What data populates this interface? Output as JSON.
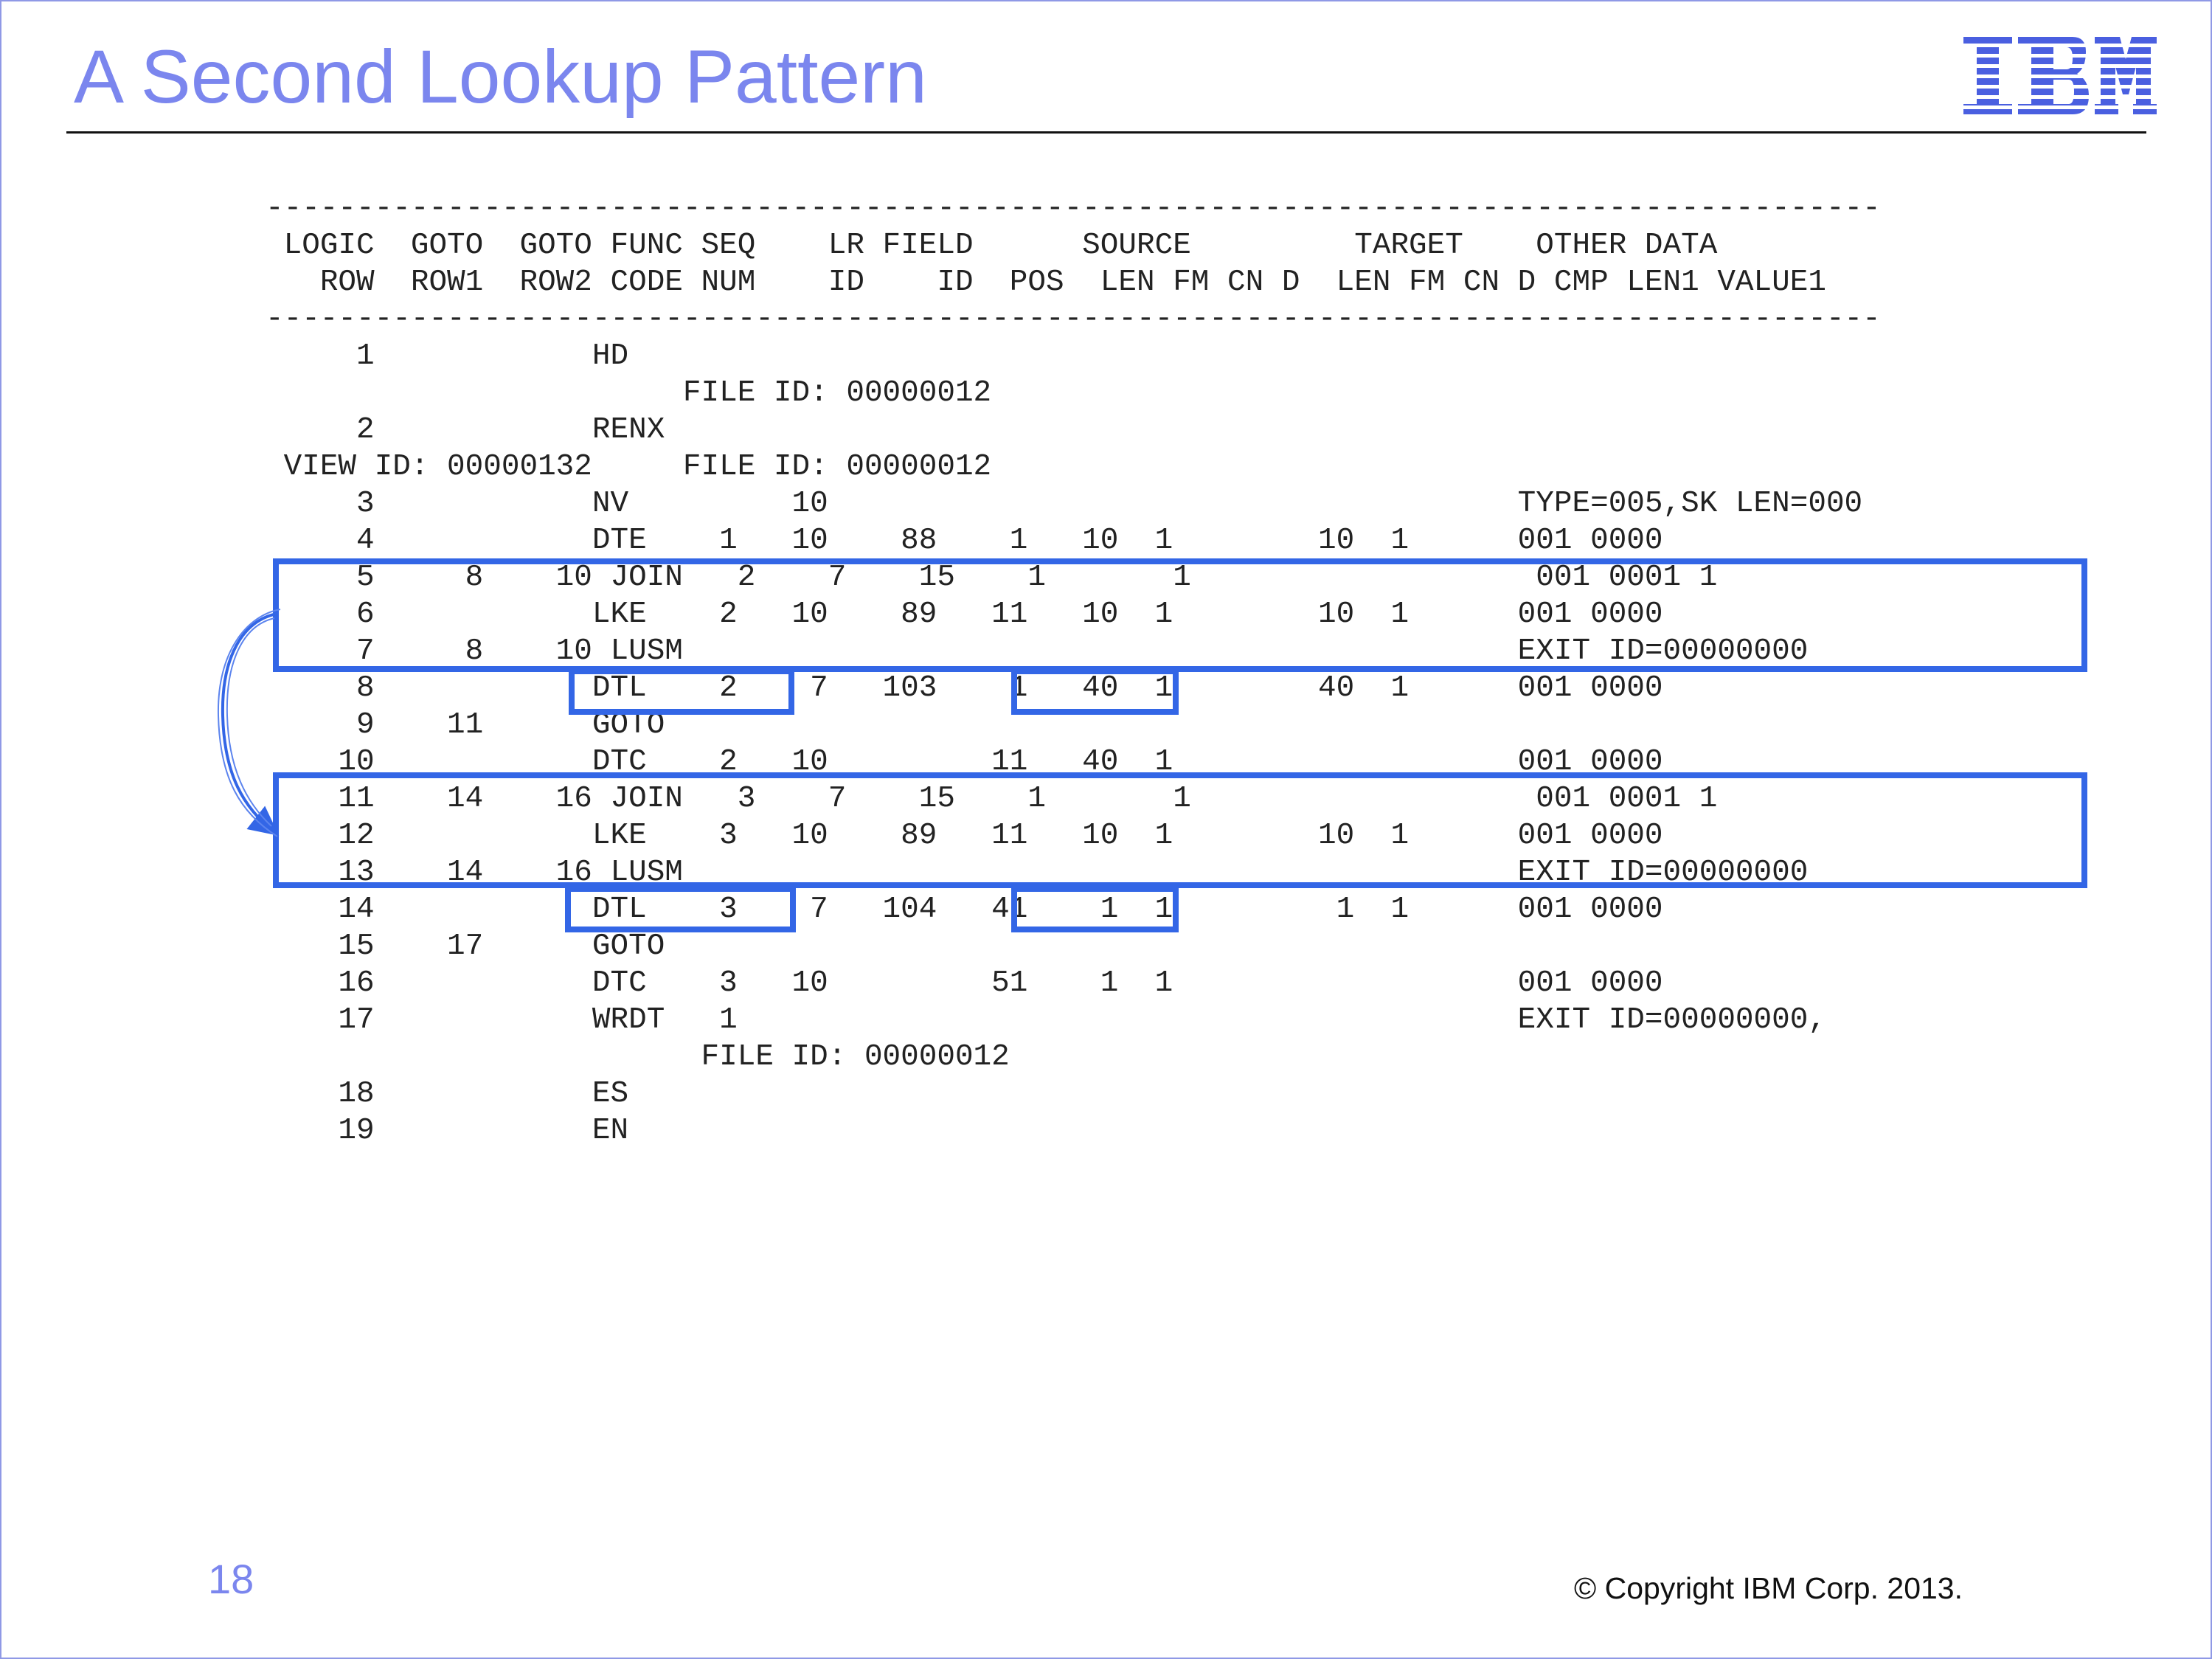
{
  "slide": {
    "title": "A Second Lookup Pattern",
    "page_number": "18",
    "copyright": "© Copyright IBM Corp. 2013.",
    "logo_text": "IBM",
    "accent_color": "#7b86ee",
    "highlight_color": "#3366e6"
  },
  "listing": {
    "separator_top": "-----------------------------------------------------------------------------------------",
    "header_line1": "LOGIC  GOTO  GOTO FUNC SEQ    LR FIELD      SOURCE         TARGET    OTHER DATA",
    "header_line2": "  ROW  ROW1  ROW2 CODE NUM    ID    ID  POS  LEN FM CN D  LEN FM CN D CMP LEN1 VALUE1",
    "separator_bottom": "-----------------------------------------------------------------------------------------",
    "rows": [
      "    1            HD",
      "                      FILE ID: 00000012",
      "    2            RENX",
      "VIEW ID: 00000132     FILE ID: 00000012",
      "    3            NV         10                                      TYPE=005,SK LEN=000",
      "    4            DTE    1   10    88    1   10  1        10  1      001 0000",
      "    5     8    10 JOIN   2    7    15    1       1                   001 0001 1",
      "    6            LKE    2   10    89   11   10  1        10  1      001 0000",
      "    7     8    10 LUSM                                              EXIT ID=00000000",
      "    8            DTL    2    7   103    1   40  1        40  1      001 0000",
      "    9    11      GOTO",
      "   10            DTC    2   10         11   40  1                   001 0000",
      "   11    14    16 JOIN   3    7    15    1       1                   001 0001 1",
      "   12            LKE    3   10    89   11   10  1        10  1      001 0000",
      "   13    14    16 LUSM                                              EXIT ID=00000000",
      "   14            DTL    3    7   104   41    1  1         1  1      001 0000",
      "   15    17      GOTO",
      "   16            DTC    3   10         51    1  1                   001 0000",
      "   17            WRDT   1                                           EXIT ID=00000000,",
      "                       FILE ID: 00000012",
      "   18            ES",
      "   19            EN"
    ]
  }
}
